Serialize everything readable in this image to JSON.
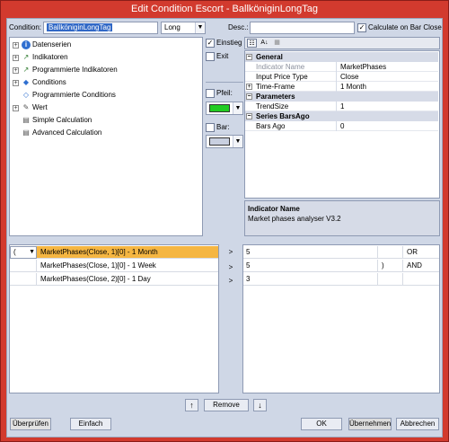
{
  "window": {
    "title": "Edit Condition Escort - BallköniginLongTag"
  },
  "header": {
    "condition_label": "Condition:",
    "condition_value": "BallköniginLongTag",
    "direction_value": "Long",
    "desc_label": "Desc.:",
    "desc_value": "",
    "calc_on_bar_close_label": "Calculate on Bar Close",
    "calc_on_bar_close_checked": true
  },
  "tree": {
    "items": [
      {
        "label": "Datenserien",
        "expandable": true,
        "icon": "info-icon"
      },
      {
        "label": "Indikatoren",
        "expandable": true,
        "icon": "indicator-icon"
      },
      {
        "label": "Programmierte Indikatoren",
        "expandable": true,
        "icon": "programmed-indicator-icon"
      },
      {
        "label": "Conditions",
        "expandable": true,
        "icon": "conditions-icon"
      },
      {
        "label": "Programmierte Conditions",
        "expandable": false,
        "icon": "programmed-conditions-icon"
      },
      {
        "label": "Wert",
        "expandable": true,
        "icon": "value-icon"
      },
      {
        "label": "Simple Calculation",
        "expandable": false,
        "icon": "calculation-icon"
      },
      {
        "label": "Advanced Calculation",
        "expandable": false,
        "icon": "calculation-icon"
      }
    ]
  },
  "options": {
    "einstieg_label": "Einstieg",
    "einstieg_checked": true,
    "exit_label": "Exit",
    "exit_checked": false,
    "pfeil_label": "Pfeil:",
    "pfeil_checked": false,
    "pfeil_color": "#22cc22",
    "bar_label": "Bar:",
    "bar_checked": false,
    "bar_color": "#c9d0e0"
  },
  "property_grid": {
    "categories": [
      {
        "name": "General",
        "rows": [
          {
            "name": "Indicator Name",
            "value": "MarketPhases",
            "disabled": true
          },
          {
            "name": "Input Price Type",
            "value": "Close"
          },
          {
            "name": "Time-Frame",
            "value": "1 Month",
            "expandable": true
          }
        ]
      },
      {
        "name": "Parameters",
        "rows": [
          {
            "name": "TrendSize",
            "value": "1"
          }
        ]
      },
      {
        "name": "Series BarsAgo",
        "rows": [
          {
            "name": "Bars Ago",
            "value": "0"
          }
        ]
      }
    ]
  },
  "description": {
    "title": "Indicator Name",
    "text": "Market phases analyser V3.2"
  },
  "conditions": {
    "rows": [
      {
        "paren": "(",
        "expr": "MarketPhases(Close, 1)[0] - 1 Month",
        "arrow": ">",
        "value": "5",
        "close_paren": "",
        "logic": "OR",
        "selected": true
      },
      {
        "paren": "",
        "expr": "MarketPhases(Close, 1)[0] - 1 Week",
        "arrow": ">",
        "value": "5",
        "close_paren": ")",
        "logic": "AND",
        "selected": false
      },
      {
        "paren": "",
        "expr": "MarketPhases(Close, 2)[0] - 1 Day",
        "arrow": ">",
        "value": "3",
        "close_paren": "",
        "logic": "",
        "selected": false
      }
    ]
  },
  "buttons": {
    "remove": "Remove",
    "ueberpruefen": "Überprüfen",
    "einfach": "Einfach",
    "ok": "OK",
    "uebernehmen": "Übernehmen",
    "abbrechen": "Abbrechen"
  },
  "colors": {
    "title_bar": "#d23a2e",
    "dialog_bg": "#cfd7e6",
    "selection": "#3168c6",
    "row_highlight": "#f5b642"
  }
}
